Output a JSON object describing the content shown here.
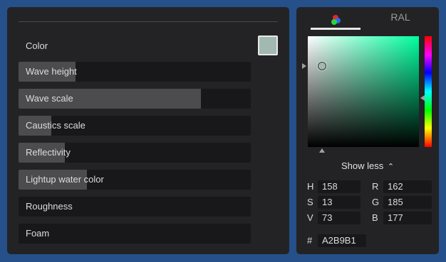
{
  "properties": {
    "color_label": "Color",
    "color_value": "#A2B9B1",
    "sliders": [
      {
        "label": "Wave height",
        "fill_fraction": 0.245
      },
      {
        "label": "Wave scale",
        "fill_fraction": 0.785
      },
      {
        "label": "Caustics scale",
        "fill_fraction": 0.14
      },
      {
        "label": "Reflectivity",
        "fill_fraction": 0.2
      },
      {
        "label": "Lightup water color",
        "fill_fraction": 0.295
      },
      {
        "label": "Roughness",
        "fill_fraction": 0
      },
      {
        "label": "Foam",
        "fill_fraction": 0
      }
    ]
  },
  "picker": {
    "tabs": {
      "wheel_icon": "rgb-dots-icon",
      "ral_label": "RAL"
    },
    "saturation": 0.13,
    "value": 0.73,
    "hue_fraction": 0.56,
    "show_less_label": "Show less",
    "hsv": {
      "h_label": "H",
      "h_value": "158",
      "s_label": "S",
      "s_value": "13",
      "v_label": "V",
      "v_value": "73"
    },
    "rgb": {
      "r_label": "R",
      "r_value": "162",
      "g_label": "G",
      "g_value": "185",
      "b_label": "B",
      "b_value": "177"
    },
    "hex_label": "#",
    "hex_value": "A2B9B1"
  }
}
